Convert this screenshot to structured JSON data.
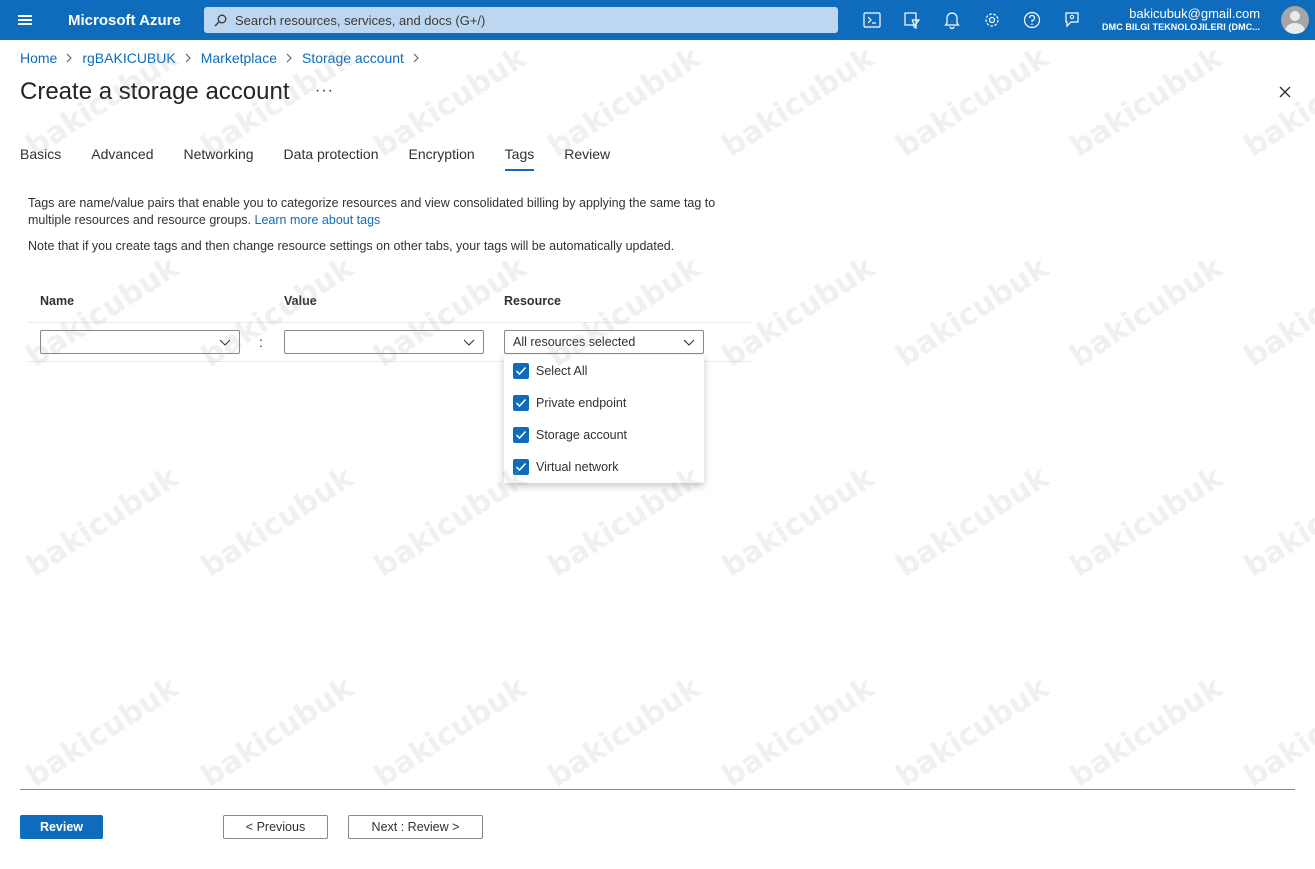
{
  "topbar": {
    "brand": "Microsoft Azure",
    "search_placeholder": "Search resources, services, and docs (G+/)",
    "icons": [
      "cloud-shell-icon",
      "directory-filter-icon",
      "notifications-icon",
      "settings-icon",
      "help-icon",
      "feedback-icon"
    ],
    "account_email": "bakicubuk@gmail.com",
    "account_org": "DMC BILGI TEKNOLOJILERI (DMC..."
  },
  "breadcrumb": [
    "Home",
    "rgBAKICUBUK",
    "Marketplace",
    "Storage account"
  ],
  "page": {
    "title": "Create a storage account",
    "more": "···"
  },
  "tabs": [
    {
      "label": "Basics"
    },
    {
      "label": "Advanced"
    },
    {
      "label": "Networking"
    },
    {
      "label": "Data protection"
    },
    {
      "label": "Encryption"
    },
    {
      "label": "Tags",
      "active": true
    },
    {
      "label": "Review"
    }
  ],
  "description": {
    "text": "Tags are name/value pairs that enable you to categorize resources and view consolidated billing by applying the same tag to multiple resources and resource groups.",
    "link": "Learn more about tags",
    "note": "Note that if you create tags and then change resource settings on other tabs, your tags will be automatically updated."
  },
  "grid": {
    "headers": {
      "name": "Name",
      "value": "Value",
      "resource": "Resource"
    },
    "row": {
      "name": "",
      "separator": ":",
      "value": "",
      "resource": "All resources selected"
    }
  },
  "resource_options": [
    {
      "label": "Select All",
      "checked": true
    },
    {
      "label": "Private endpoint",
      "checked": true
    },
    {
      "label": "Storage account",
      "checked": true
    },
    {
      "label": "Virtual network",
      "checked": true
    }
  ],
  "footer": {
    "review": "Review",
    "previous": "< Previous",
    "next": "Next : Review >"
  },
  "watermark": "bakicubuk",
  "colors": {
    "accent": "#0f6cbd",
    "topbar": "#0f6cbd"
  }
}
